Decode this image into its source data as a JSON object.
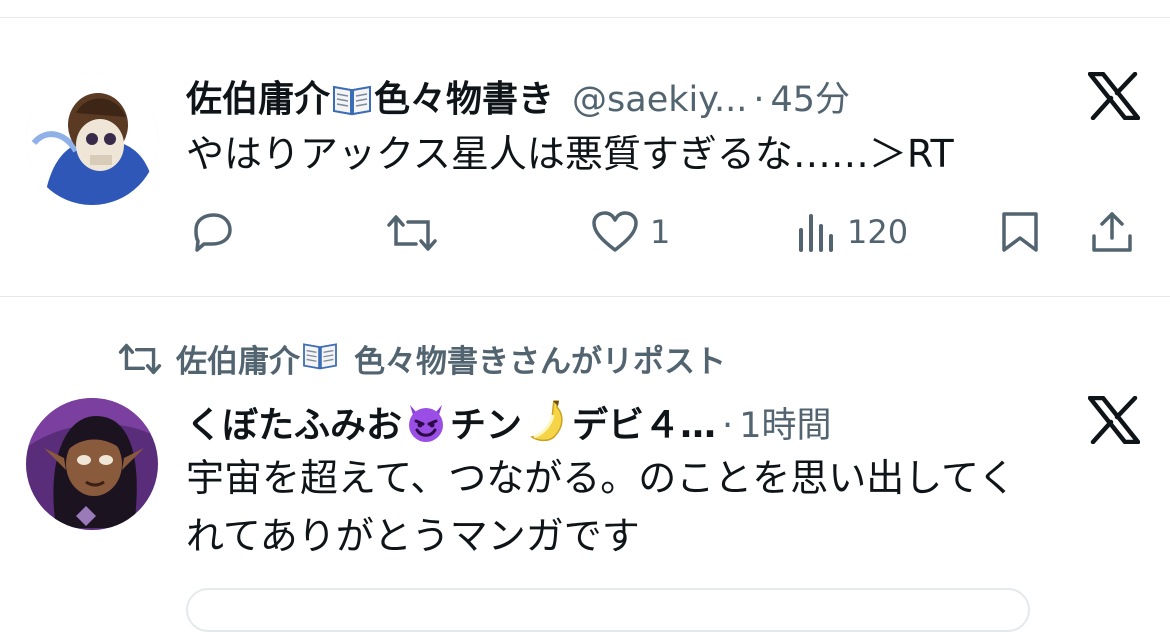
{
  "tweets": [
    {
      "author_name": "佐伯庸介",
      "author_name_suffix": "色々物書き",
      "author_emoji": "open-book-emoji",
      "handle": "@saekiy...",
      "separator": "·",
      "time": "45分",
      "text": "やはりアックス星人は悪質すぎるな……＞RT",
      "replies": "",
      "reposts": "",
      "likes": "1",
      "views": "120"
    },
    {
      "repost_context": "佐伯庸介📖色々物書きさんがリポスト",
      "repost_context_name": "佐伯庸介",
      "repost_context_suffix": "色々物書きさんがリポスト",
      "author_name_a": "くぼたふみお",
      "author_name_b": "チン",
      "author_name_c": "デビ４…",
      "emoji_1": "smiling-imp-emoji",
      "emoji_2": "banana-emoji",
      "separator": "·",
      "time": "1時間",
      "text_line1": "宇宙を超えて、つながる。のことを思い出してく",
      "text_line2": "れてありがとうマンガです"
    }
  ],
  "colors": {
    "text_primary": "#0f1419",
    "text_secondary": "#536471",
    "divider": "#e6e9ec"
  }
}
